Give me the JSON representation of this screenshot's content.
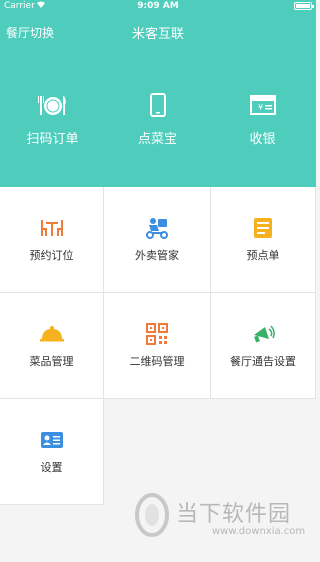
{
  "status_bar": {
    "carrier": "Carrier",
    "time": "9:09 AM"
  },
  "nav": {
    "left": "餐厅切换",
    "title": "米客互联"
  },
  "hero": [
    {
      "label": "扫码订单",
      "icon": "dining-utensils-icon"
    },
    {
      "label": "点菜宝",
      "icon": "phone-icon"
    },
    {
      "label": "收银",
      "icon": "cashier-icon"
    }
  ],
  "grid": [
    {
      "label": "预约订位",
      "icon": "table-chairs-icon",
      "color": "#f07a3a"
    },
    {
      "label": "外卖管家",
      "icon": "delivery-scooter-icon",
      "color": "#3c8fe0"
    },
    {
      "label": "预点单",
      "icon": "order-list-icon",
      "color": "#f5b21e"
    },
    {
      "label": "菜品管理",
      "icon": "food-cloche-icon",
      "color": "#f5b21e"
    },
    {
      "label": "二维码管理",
      "icon": "qr-code-icon",
      "color": "#f07a3a"
    },
    {
      "label": "餐厅通告设置",
      "icon": "megaphone-icon",
      "color": "#3bb06a"
    },
    {
      "label": "设置",
      "icon": "settings-card-icon",
      "color": "#3c8fe0"
    }
  ],
  "watermark": {
    "text": "当下软件园",
    "url": "www.downxia.com"
  },
  "colors": {
    "header_bg": "#4ecdbd"
  }
}
